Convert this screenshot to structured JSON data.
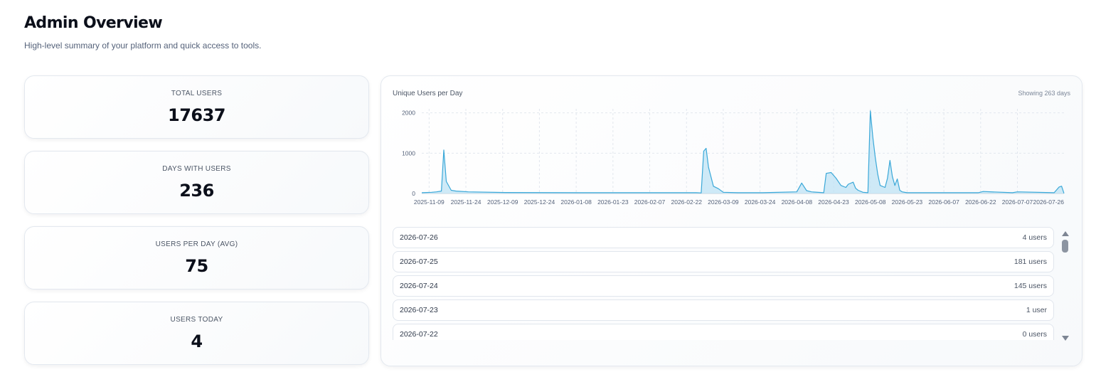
{
  "header": {
    "title": "Admin Overview",
    "subtitle": "High-level summary of your platform and quick access to tools."
  },
  "stats": [
    {
      "label": "TOTAL USERS",
      "value": "17637"
    },
    {
      "label": "DAYS WITH USERS",
      "value": "236"
    },
    {
      "label": "USERS PER DAY (AVG)",
      "value": "75"
    },
    {
      "label": "USERS TODAY",
      "value": "4"
    }
  ],
  "chart_panel": {
    "title": "Unique Users per Day",
    "range_label": "Showing 263 days"
  },
  "colors": {
    "line": "#3aa8d8",
    "fill": "#bfe3f4",
    "grid": "#e2e7ee"
  },
  "chart_data": {
    "type": "area",
    "title": "Unique Users per Day",
    "xlabel": "",
    "ylabel": "",
    "x_range": [
      "2025-11-06",
      "2026-07-26"
    ],
    "ylim": [
      0,
      2100
    ],
    "y_ticks": [
      0,
      1000,
      2000
    ],
    "x_ticks": [
      "2025-11-09",
      "2025-11-24",
      "2025-12-09",
      "2025-12-24",
      "2026-01-08",
      "2026-01-23",
      "2026-02-07",
      "2026-02-22",
      "2026-03-09",
      "2026-03-24",
      "2026-04-08",
      "2026-04-23",
      "2026-05-08",
      "2026-05-23",
      "2026-06-07",
      "2026-06-22",
      "2026-07-07",
      "2026-07-26"
    ],
    "grid": true,
    "legend": "none",
    "series": [
      {
        "x": [
          "2025-11-06",
          "2025-11-10",
          "2025-11-12",
          "2025-11-14",
          "2025-11-15",
          "2025-11-16",
          "2025-11-18",
          "2025-11-20",
          "2025-11-25",
          "2025-12-10",
          "2026-01-10",
          "2026-02-10",
          "2026-02-26",
          "2026-02-28",
          "2026-03-01",
          "2026-03-02",
          "2026-03-03",
          "2026-03-05",
          "2026-03-07",
          "2026-03-09",
          "2026-03-15",
          "2026-03-25",
          "2026-04-08",
          "2026-04-10",
          "2026-04-12",
          "2026-04-14",
          "2026-04-19",
          "2026-04-20",
          "2026-04-22",
          "2026-04-24",
          "2026-04-26",
          "2026-04-28",
          "2026-04-29",
          "2026-05-01",
          "2026-05-02",
          "2026-05-03",
          "2026-05-05",
          "2026-05-07",
          "2026-05-08",
          "2026-05-09",
          "2026-05-10",
          "2026-05-11",
          "2026-05-12",
          "2026-05-14",
          "2026-05-15",
          "2026-05-16",
          "2026-05-17",
          "2026-05-18",
          "2026-05-19",
          "2026-05-20",
          "2026-05-21",
          "2026-05-23",
          "2026-05-26",
          "2026-06-01",
          "2026-06-21",
          "2026-06-23",
          "2026-07-05",
          "2026-07-07",
          "2026-07-22",
          "2026-07-24",
          "2026-07-25",
          "2026-07-26"
        ],
        "y": [
          20,
          30,
          40,
          60,
          1080,
          300,
          80,
          60,
          40,
          25,
          20,
          20,
          20,
          15,
          1050,
          1120,
          650,
          180,
          120,
          30,
          20,
          20,
          40,
          260,
          70,
          40,
          20,
          500,
          520,
          380,
          200,
          150,
          230,
          280,
          130,
          80,
          30,
          20,
          2050,
          1400,
          900,
          480,
          200,
          150,
          380,
          820,
          420,
          200,
          360,
          80,
          40,
          20,
          20,
          20,
          20,
          50,
          20,
          40,
          20,
          160,
          181,
          4
        ]
      }
    ]
  },
  "daily_list": [
    {
      "date": "2026-07-26",
      "count": "4 users"
    },
    {
      "date": "2026-07-25",
      "count": "181 users"
    },
    {
      "date": "2026-07-24",
      "count": "145 users"
    },
    {
      "date": "2026-07-23",
      "count": "1 user"
    },
    {
      "date": "2026-07-22",
      "count": "0 users"
    }
  ]
}
